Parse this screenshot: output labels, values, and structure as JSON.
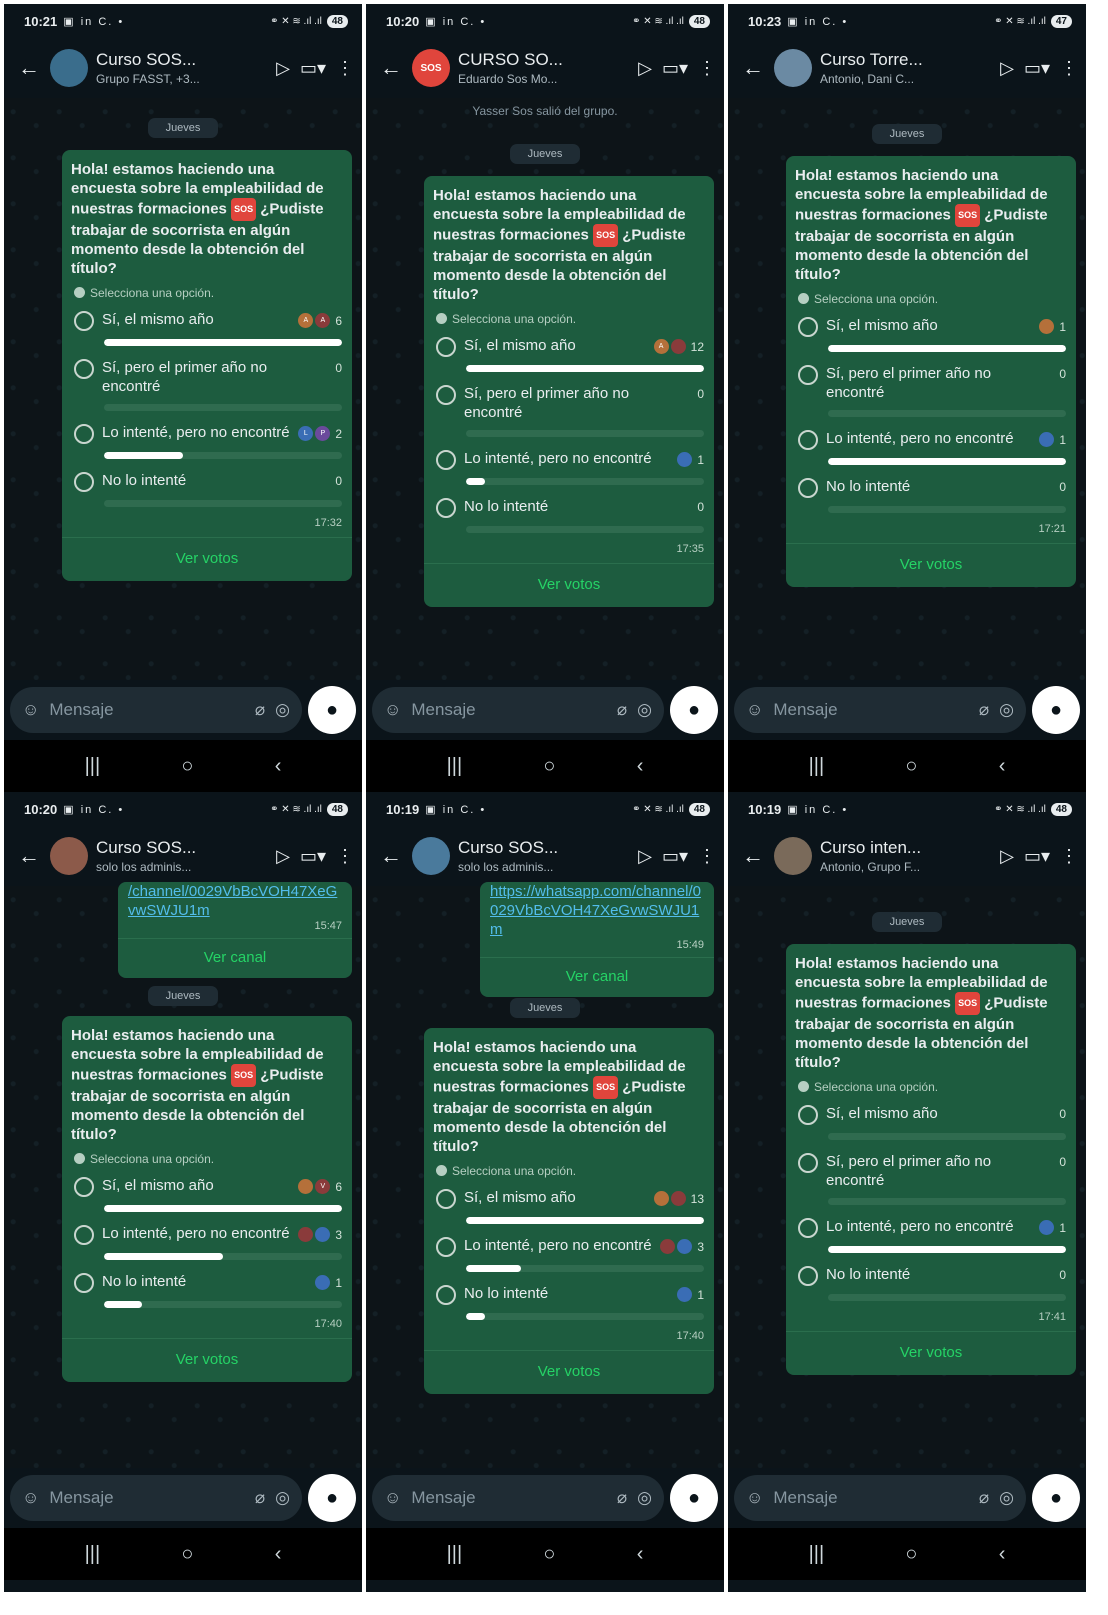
{
  "common": {
    "input_placeholder": "Mensaje",
    "vote_button": "Ver votos",
    "channel_button": "Ver canal",
    "day_label": "Jueves",
    "poll_hint": "Selecciona una opción.",
    "poll_question_part1": "Hola! estamos haciendo una encuesta sobre la empleabilidad de nuestras formaciones",
    "sos_tag": "SOS",
    "poll_question_part2": "¿Pudiste trabajar de socorrista en algún momento desde la obtención del título?",
    "icons": {
      "back": "arrow-left-icon",
      "label": "label-icon",
      "video": "video-call-icon",
      "menu": "more-vert-icon",
      "emoji": "sticker-icon",
      "attach": "paperclip-icon",
      "camera": "camera-icon",
      "mic": "mic-icon"
    }
  },
  "screens": [
    {
      "status_time": "10:21",
      "battery": "48",
      "title": "Curso SOS...",
      "subtitle": "Grupo FASST, +3...",
      "avatar_color": "#3a6d8c",
      "poll_time": "17:32",
      "options": [
        {
          "label": "Sí, el mismo año",
          "count": "6",
          "fill": 1.0,
          "voters": [
            "A",
            "A"
          ]
        },
        {
          "label": "Sí, pero el primer año no encontré",
          "count": "0",
          "fill": 0.0,
          "voters": []
        },
        {
          "label": "Lo intenté, pero no encontré",
          "count": "2",
          "fill": 0.33,
          "voters": [
            "L",
            "P"
          ]
        },
        {
          "label": "No lo intenté",
          "count": "0",
          "fill": 0.0,
          "voters": []
        }
      ]
    },
    {
      "status_time": "10:20",
      "battery": "48",
      "title": "CURSO SO...",
      "subtitle": "Eduardo Sos Mo...",
      "avatar_color": "#e0453c",
      "avatar_text": "SOS",
      "system_message": "Yasser Sos salió del grupo.",
      "poll_time": "17:35",
      "options": [
        {
          "label": "Sí, el mismo año",
          "count": "12",
          "fill": 1.0,
          "voters": [
            "A",
            ""
          ]
        },
        {
          "label": "Sí, pero el primer año no encontré",
          "count": "0",
          "fill": 0.0,
          "voters": []
        },
        {
          "label": "Lo intenté, pero no encontré",
          "count": "1",
          "fill": 0.08,
          "voters": [
            ""
          ]
        },
        {
          "label": "No lo intenté",
          "count": "0",
          "fill": 0.0,
          "voters": []
        }
      ]
    },
    {
      "status_time": "10:23",
      "battery": "47",
      "title": "Curso Torre...",
      "subtitle": "Antonio, Dani C...",
      "avatar_color": "#6b8aa3",
      "poll_time": "17:21",
      "options": [
        {
          "label": "Sí, el mismo año",
          "count": "1",
          "fill": 1.0,
          "voters": [
            ""
          ]
        },
        {
          "label": "Sí, pero el primer año no encontré",
          "count": "0",
          "fill": 0.0,
          "voters": []
        },
        {
          "label": "Lo intenté, pero no encontré",
          "count": "1",
          "fill": 1.0,
          "voters": [
            ""
          ]
        },
        {
          "label": "No lo intenté",
          "count": "0",
          "fill": 0.0,
          "voters": []
        }
      ]
    },
    {
      "status_time": "10:20",
      "battery": "48",
      "title": "Curso SOS...",
      "subtitle": "solo los adminis...",
      "avatar_color": "#8c5a4a",
      "channel_link": "/channel/0029VbBcVOH47XeGvwSWJU1m",
      "channel_time": "15:47",
      "poll_time": "17:40",
      "options": [
        {
          "label": "Sí, el mismo año",
          "count": "6",
          "fill": 1.0,
          "voters": [
            "",
            "V"
          ]
        },
        {
          "label": "Lo intenté, pero no encontré",
          "count": "3",
          "fill": 0.5,
          "voters": [
            "",
            ""
          ]
        },
        {
          "label": "No lo intenté",
          "count": "1",
          "fill": 0.16,
          "voters": [
            ""
          ]
        }
      ]
    },
    {
      "status_time": "10:19",
      "battery": "48",
      "title": "Curso SOS...",
      "subtitle": "solo los adminis...",
      "avatar_color": "#4a7a9c",
      "channel_link": "https://whatsapp.com/channel/0029VbBcVOH47XeGvwSWJU1m",
      "channel_time": "15:49",
      "poll_time": "17:40",
      "options": [
        {
          "label": "Sí, el mismo año",
          "count": "13",
          "fill": 1.0,
          "voters": [
            "",
            ""
          ]
        },
        {
          "label": "Lo intenté, pero no encontré",
          "count": "3",
          "fill": 0.23,
          "voters": [
            "",
            ""
          ]
        },
        {
          "label": "No lo intenté",
          "count": "1",
          "fill": 0.08,
          "voters": [
            ""
          ]
        }
      ]
    },
    {
      "status_time": "10:19",
      "battery": "48",
      "title": "Curso inten...",
      "subtitle": "Antonio, Grupo F...",
      "avatar_color": "#7a6a5a",
      "poll_time": "17:41",
      "options": [
        {
          "label": "Sí, el mismo año",
          "count": "0",
          "fill": 0.0,
          "voters": []
        },
        {
          "label": "Sí, pero el primer año no encontré",
          "count": "0",
          "fill": 0.0,
          "voters": []
        },
        {
          "label": "Lo intenté, pero no encontré",
          "count": "1",
          "fill": 1.0,
          "voters": [
            ""
          ]
        },
        {
          "label": "No lo intenté",
          "count": "0",
          "fill": 0.0,
          "voters": []
        }
      ]
    }
  ]
}
